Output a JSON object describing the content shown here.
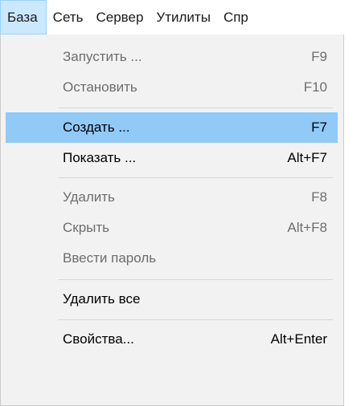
{
  "menubar": {
    "items": [
      {
        "label": "База"
      },
      {
        "label": "Сеть"
      },
      {
        "label": "Сервер"
      },
      {
        "label": "Утилиты"
      },
      {
        "label": "Спр"
      }
    ]
  },
  "menu": {
    "items": [
      {
        "label": "Запустить ...",
        "shortcut": "F9",
        "state": "disabled"
      },
      {
        "label": "Остановить",
        "shortcut": "F10",
        "state": "disabled"
      },
      {
        "label": "Создать ...",
        "shortcut": "F7",
        "state": "highlighted"
      },
      {
        "label": "Показать ...",
        "shortcut": "Alt+F7",
        "state": "enabled"
      },
      {
        "label": "Удалить",
        "shortcut": "F8",
        "state": "disabled"
      },
      {
        "label": "Скрыть",
        "shortcut": "Alt+F8",
        "state": "disabled"
      },
      {
        "label": "Ввести пароль",
        "shortcut": "",
        "state": "disabled"
      },
      {
        "label": "Удалить все",
        "shortcut": "",
        "state": "enabled"
      },
      {
        "label": "Свойства...",
        "shortcut": "Alt+Enter",
        "state": "enabled"
      }
    ]
  },
  "colors": {
    "menu_background": "#f2f2f2",
    "highlight": "#91c9f7",
    "active_menubar": "#cce8ff",
    "disabled_text": "#6d6d6d"
  }
}
